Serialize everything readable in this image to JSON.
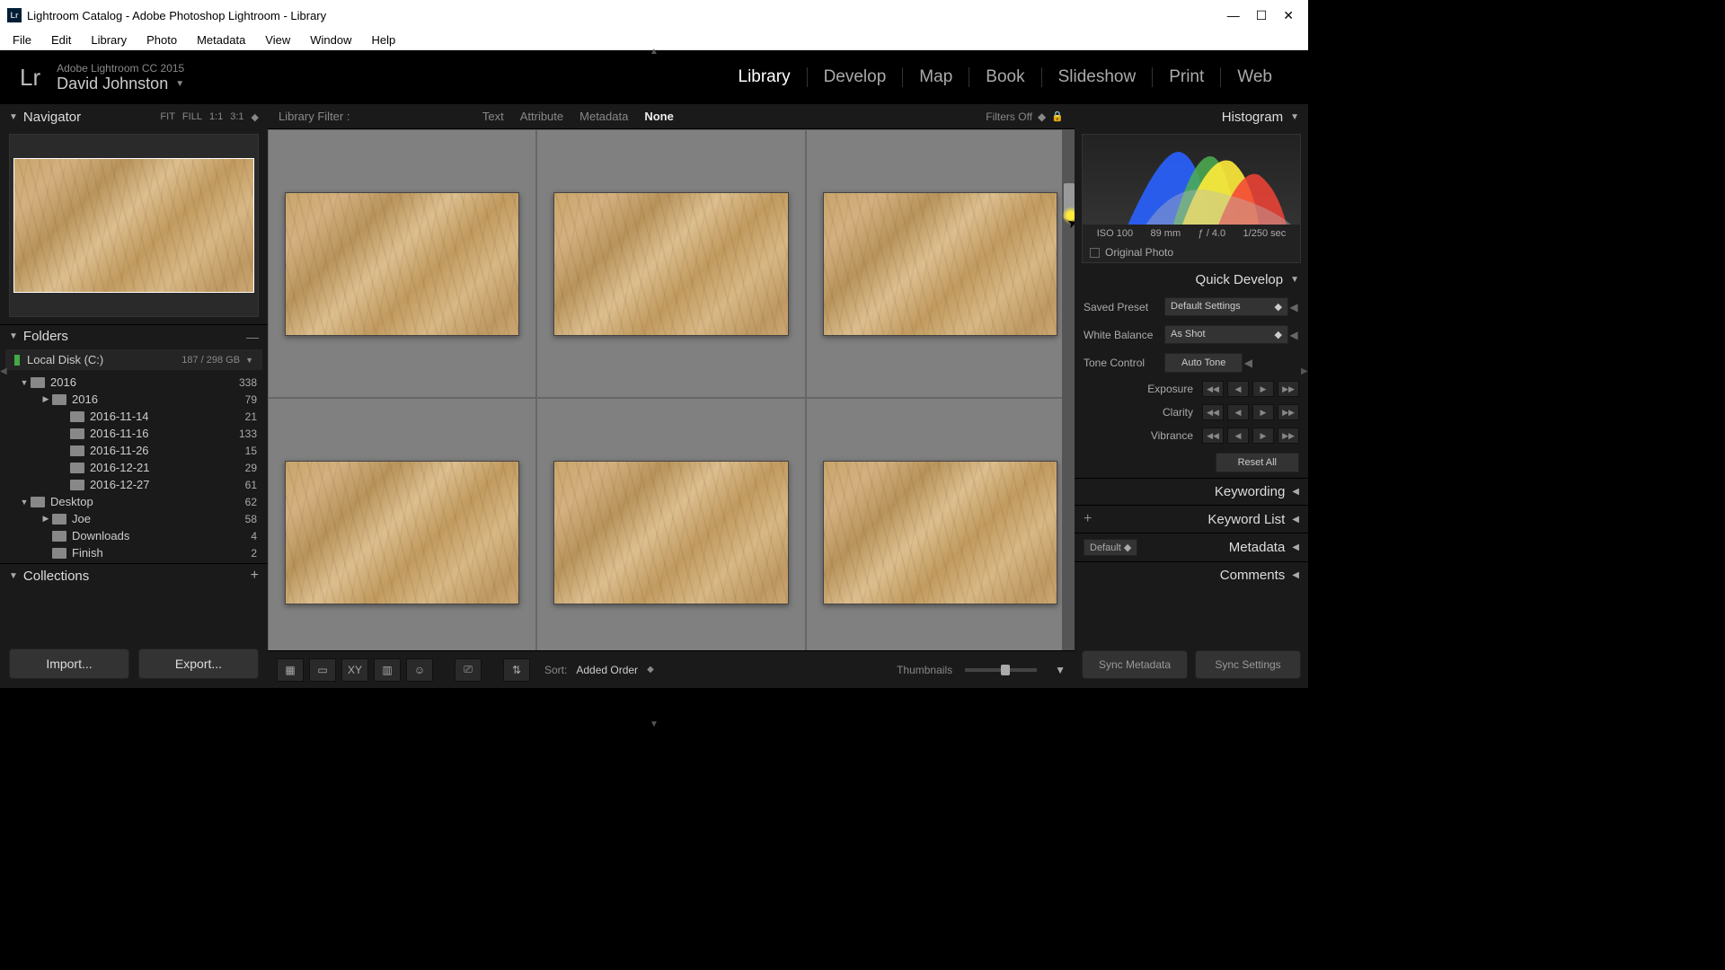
{
  "window": {
    "title": "Lightroom Catalog - Adobe Photoshop Lightroom - Library"
  },
  "menu": [
    "File",
    "Edit",
    "Library",
    "Photo",
    "Metadata",
    "View",
    "Window",
    "Help"
  ],
  "header": {
    "logo": "Lr",
    "product": "Adobe Lightroom CC 2015",
    "user": "David Johnston",
    "modules": [
      "Library",
      "Develop",
      "Map",
      "Book",
      "Slideshow",
      "Print",
      "Web"
    ],
    "active_module": "Library"
  },
  "navigator": {
    "title": "Navigator",
    "zoom": [
      "FIT",
      "FILL",
      "1:1",
      "3:1"
    ]
  },
  "folders": {
    "title": "Folders",
    "disk": {
      "name": "Local Disk (C:)",
      "usage": "187 / 298 GB"
    },
    "tree": [
      {
        "name": "2016",
        "count": "338",
        "level": 1,
        "expand": "▼"
      },
      {
        "name": "2016",
        "count": "79",
        "level": 2,
        "expand": "▶"
      },
      {
        "name": "2016-11-14",
        "count": "21",
        "level": 3,
        "expand": ""
      },
      {
        "name": "2016-11-16",
        "count": "133",
        "level": 3,
        "expand": ""
      },
      {
        "name": "2016-11-26",
        "count": "15",
        "level": 3,
        "expand": ""
      },
      {
        "name": "2016-12-21",
        "count": "29",
        "level": 3,
        "expand": ""
      },
      {
        "name": "2016-12-27",
        "count": "61",
        "level": 3,
        "expand": ""
      },
      {
        "name": "Desktop",
        "count": "62",
        "level": 1,
        "expand": "▼"
      },
      {
        "name": "Joe",
        "count": "58",
        "level": 2,
        "expand": "▶"
      },
      {
        "name": "Downloads",
        "count": "4",
        "level": 2,
        "expand": ""
      },
      {
        "name": "Finish",
        "count": "2",
        "level": 2,
        "expand": ""
      }
    ]
  },
  "collections": {
    "title": "Collections"
  },
  "left_buttons": {
    "import": "Import...",
    "export": "Export..."
  },
  "filter": {
    "label": "Library Filter :",
    "tabs": [
      "Text",
      "Attribute",
      "Metadata",
      "None"
    ],
    "active": "None",
    "status": "Filters Off"
  },
  "toolbar": {
    "sort_label": "Sort:",
    "sort_value": "Added Order",
    "thumbnails": "Thumbnails"
  },
  "histogram": {
    "title": "Histogram",
    "iso": "ISO 100",
    "focal": "89 mm",
    "aperture": "ƒ / 4.0",
    "shutter": "1/250 sec",
    "original": "Original Photo"
  },
  "quick_develop": {
    "title": "Quick Develop",
    "preset_label": "Saved Preset",
    "preset_value": "Default Settings",
    "wb_label": "White Balance",
    "wb_value": "As Shot",
    "tone_label": "Tone Control",
    "auto_tone": "Auto Tone",
    "exposure": "Exposure",
    "clarity": "Clarity",
    "vibrance": "Vibrance",
    "reset": "Reset All"
  },
  "sections": {
    "keywording": "Keywording",
    "keyword_list": "Keyword List",
    "metadata": "Metadata",
    "metadata_preset": "Default",
    "comments": "Comments"
  },
  "right_buttons": {
    "sync_meta": "Sync Metadata",
    "sync_settings": "Sync Settings"
  }
}
